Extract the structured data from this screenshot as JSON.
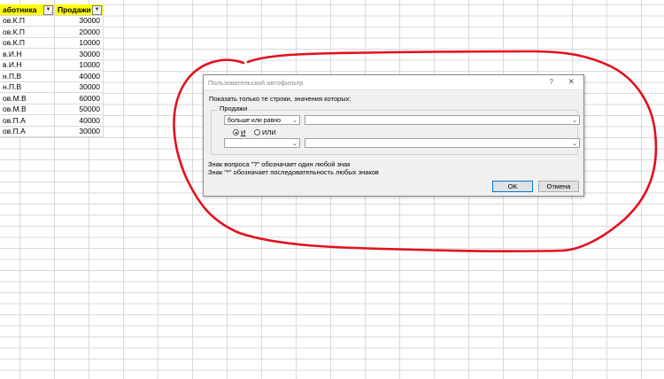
{
  "sheet": {
    "headers": [
      "аботника",
      "Продажи"
    ],
    "rows": [
      {
        "name": "ов.К.П",
        "sales": "30000"
      },
      {
        "name": "ов.К.П",
        "sales": "20000"
      },
      {
        "name": "ов.К.П",
        "sales": "10000"
      },
      {
        "name": "в.И.Н",
        "sales": "30000"
      },
      {
        "name": "в.И.Н",
        "sales": "10000"
      },
      {
        "name": "н.П.В",
        "sales": "40000"
      },
      {
        "name": "н.П.В",
        "sales": "30000"
      },
      {
        "name": "ов.М.В",
        "sales": "60000"
      },
      {
        "name": "ов.М.В",
        "sales": "50000"
      },
      {
        "name": "ов.П.А",
        "sales": "40000"
      },
      {
        "name": "ов.П.А",
        "sales": "30000"
      }
    ],
    "header_fill": "#ffff00"
  },
  "annotation": {
    "color": "#e3101e"
  },
  "dialog": {
    "title": "Пользовательский автофильтр",
    "help": "?",
    "close": "✕",
    "instruction": "Показать только те строки, значения которых:",
    "field": "Продажи",
    "condition1_operator": "больше или равно",
    "condition1_value": "",
    "and_label": "И",
    "or_label": "ИЛИ",
    "logic_selected": "И",
    "condition2_operator": "",
    "condition2_value": "",
    "hint1": "Знак вопроса \"?\" обозначает один любой знак",
    "hint2": "Знак \"*\" обозначает последовательность любых знаков",
    "ok": "OK",
    "cancel": "Отмена"
  }
}
